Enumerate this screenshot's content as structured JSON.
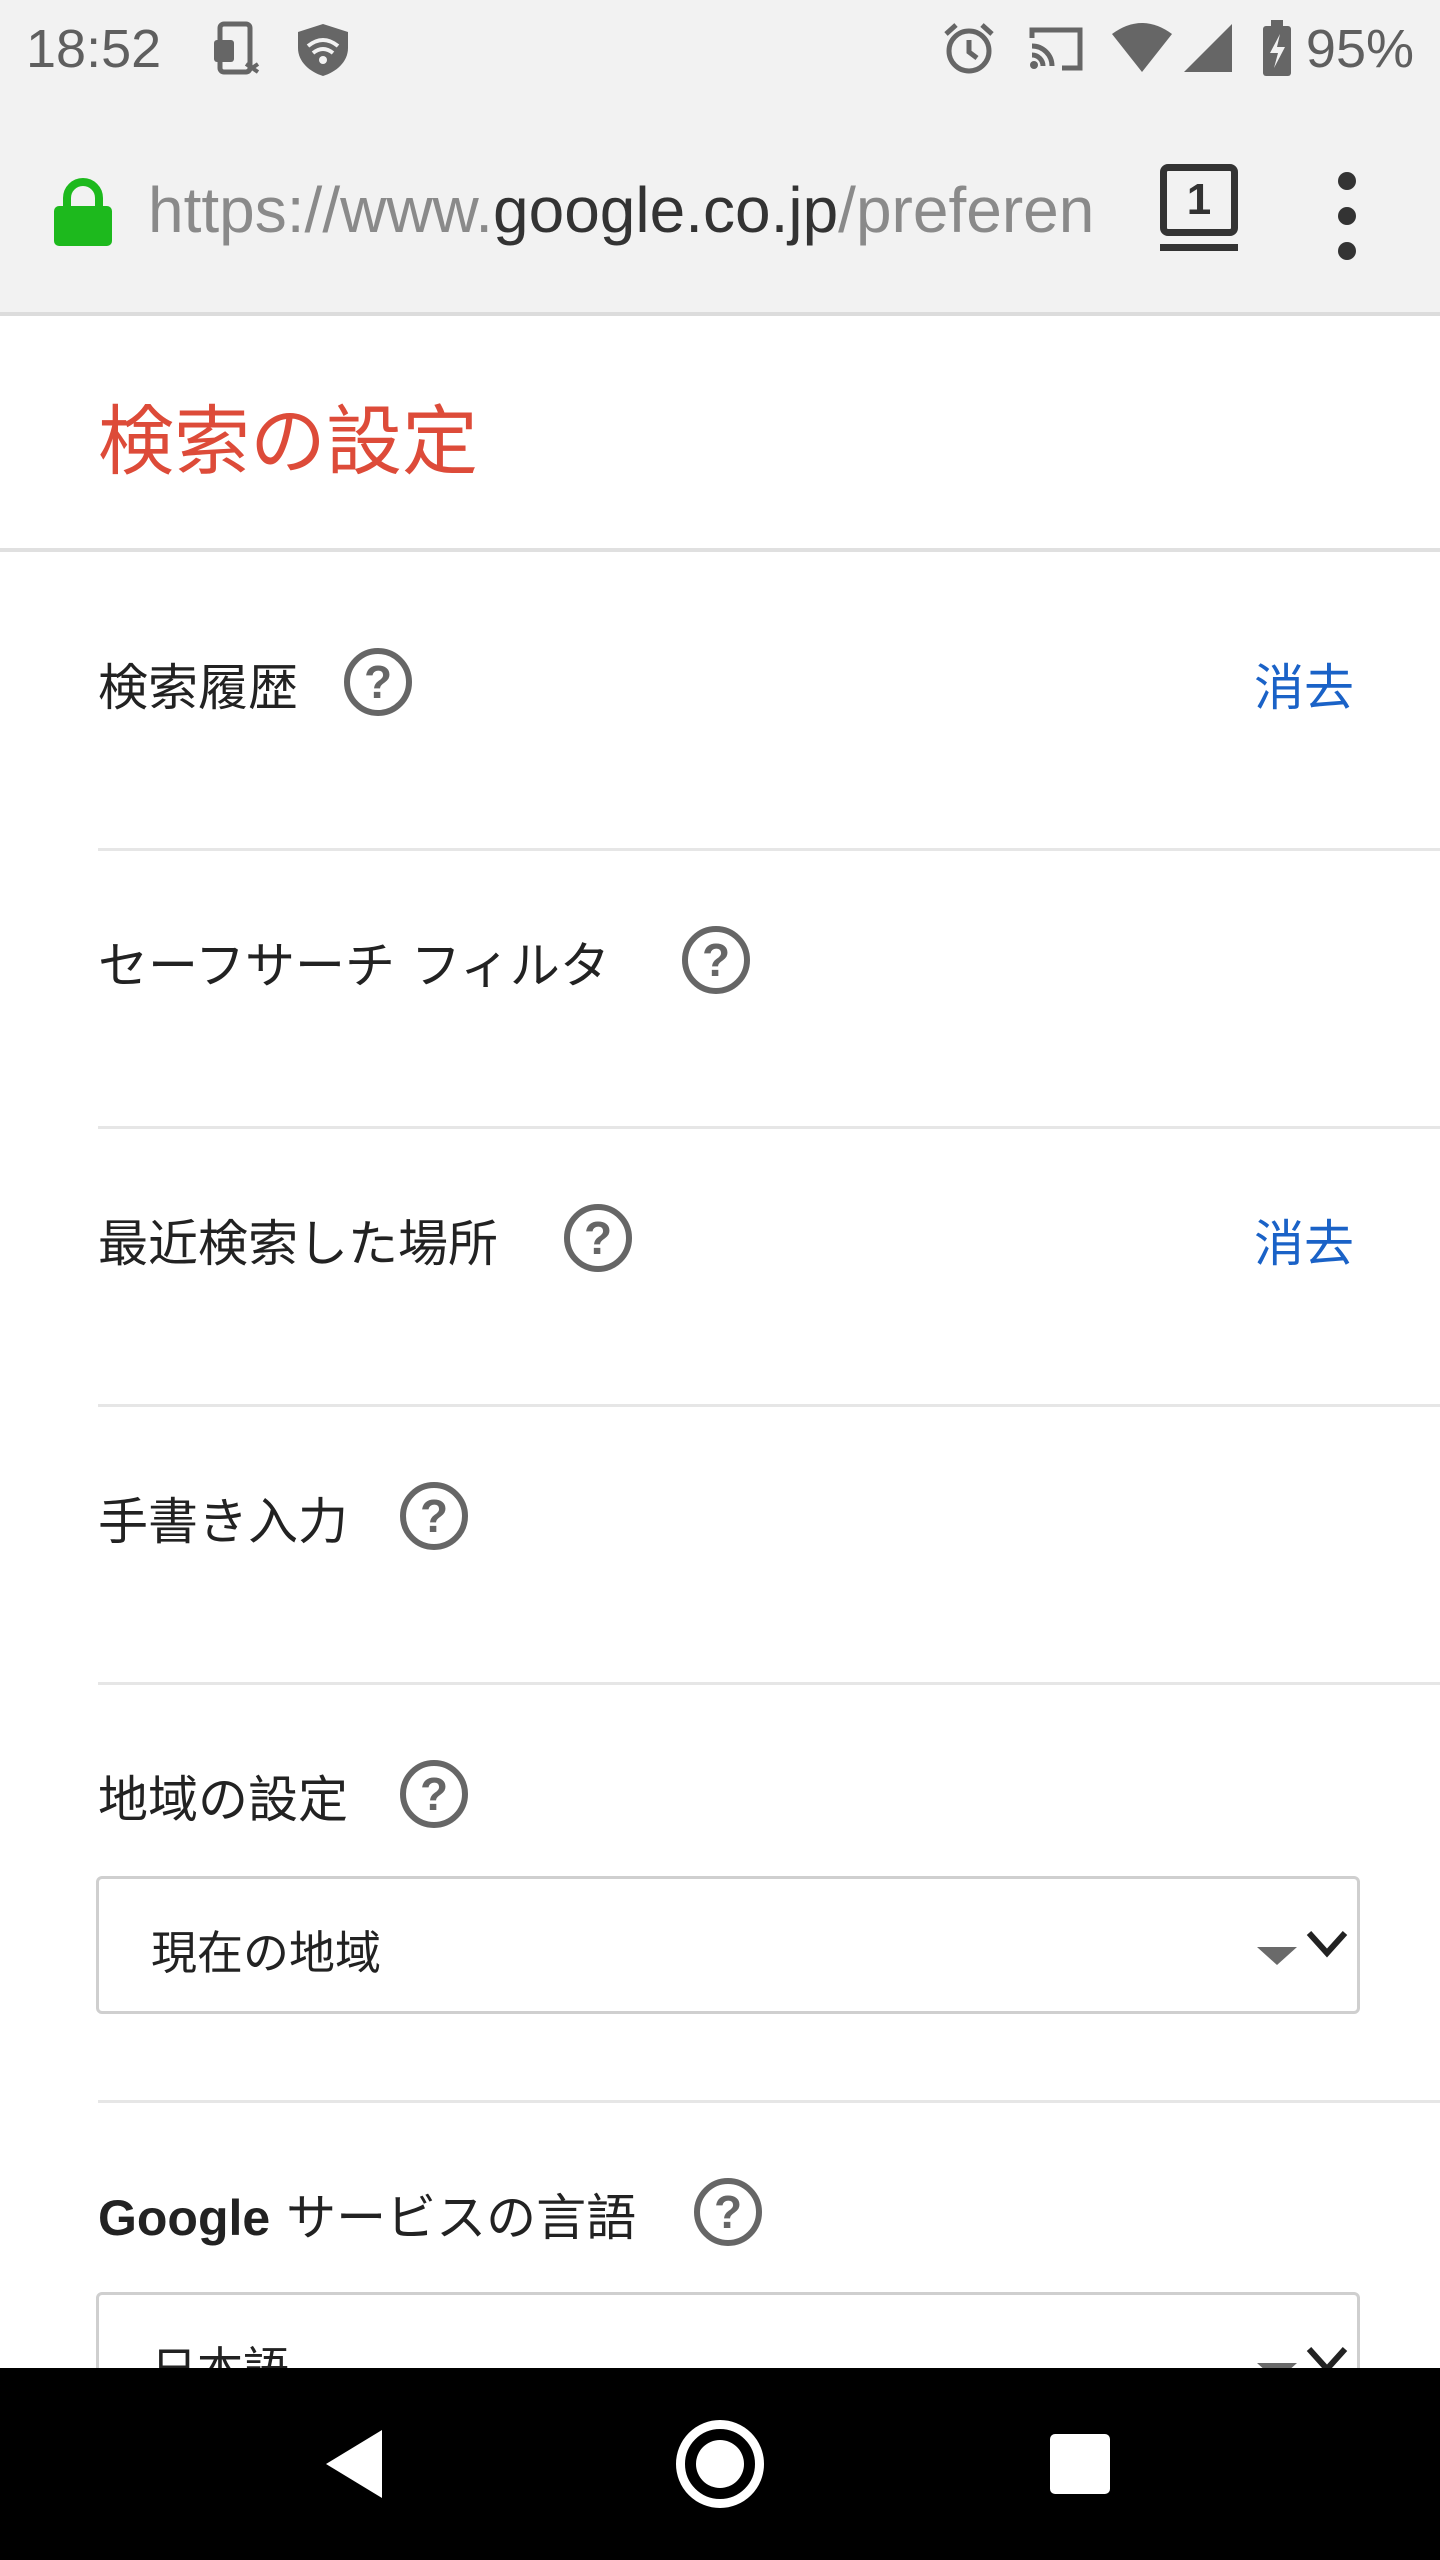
{
  "status_bar": {
    "time": "18:52",
    "battery_percent": "95%",
    "icons": [
      "screen-share-icon",
      "vpn-shield-icon",
      "alarm-icon",
      "cast-icon",
      "wifi-icon",
      "signal-icon",
      "battery-charging-icon"
    ]
  },
  "browser": {
    "url_scheme": "https://www.",
    "url_host": "google.co.jp",
    "url_path": "/preferen",
    "tab_count": "1"
  },
  "page": {
    "title": "検索の設定",
    "rows": [
      {
        "label": "検索履歴",
        "link": "消去"
      },
      {
        "label": "セーフサーチ フィルタ"
      },
      {
        "label": "最近検索した場所",
        "link": "消去"
      },
      {
        "label": "手書き入力"
      },
      {
        "label": "地域の設定",
        "select_value": "現在の地域"
      },
      {
        "label_prefix": "Google",
        "label": " サービスの言語",
        "select_value": "日本語"
      }
    ],
    "help_glyph": "?"
  },
  "colors": {
    "title": "#dd4b39",
    "link": "#1a62c7",
    "lock": "#1db91d"
  }
}
